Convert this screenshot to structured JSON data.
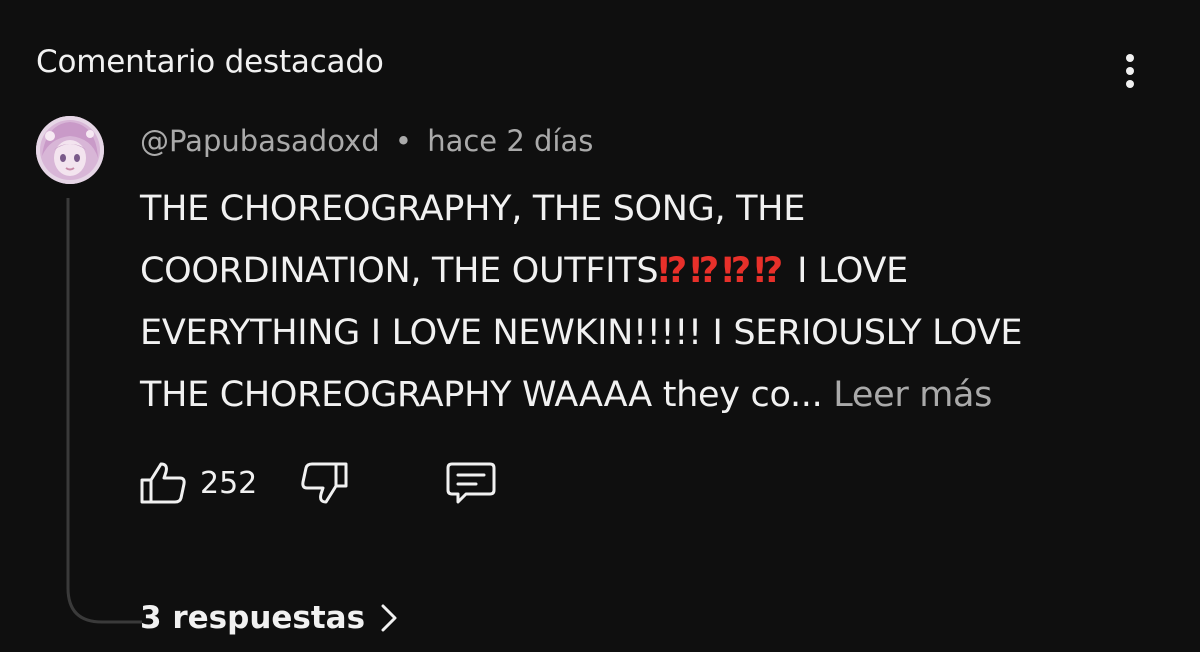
{
  "header": {
    "title": "Comentario destacado",
    "menu_icon": "more-vertical-icon"
  },
  "comment": {
    "avatar_icon": "avatar-pink-hair",
    "author": "@Papubasadoxd",
    "separator": "•",
    "time": "hace 2 días",
    "lines": {
      "l1": "THE CHOREOGRAPHY, THE SONG, THE",
      "l2_a": "COORDINATION, THE OUTFITS",
      "l2_emoji": "⁉⁉⁉⁉",
      "l2_b": " I LOVE",
      "l3": "EVERYTHING I LOVE NEWKIN!!!!! I SERIOUSLY LOVE",
      "l4": "THE CHOREOGRAPHY WAAAA they co... "
    },
    "read_more": "Leer más",
    "likes": "252",
    "replies_label": "3 respuestas"
  },
  "icons": {
    "like": "thumbs-up-icon",
    "dislike": "thumbs-down-icon",
    "reply": "comment-icon",
    "chevron": "chevron-right-icon"
  },
  "colors": {
    "background": "#0f0f0f",
    "text": "#f1f1f1",
    "secondary_text": "#aaaaaa",
    "emoji_red": "#e8302a"
  }
}
